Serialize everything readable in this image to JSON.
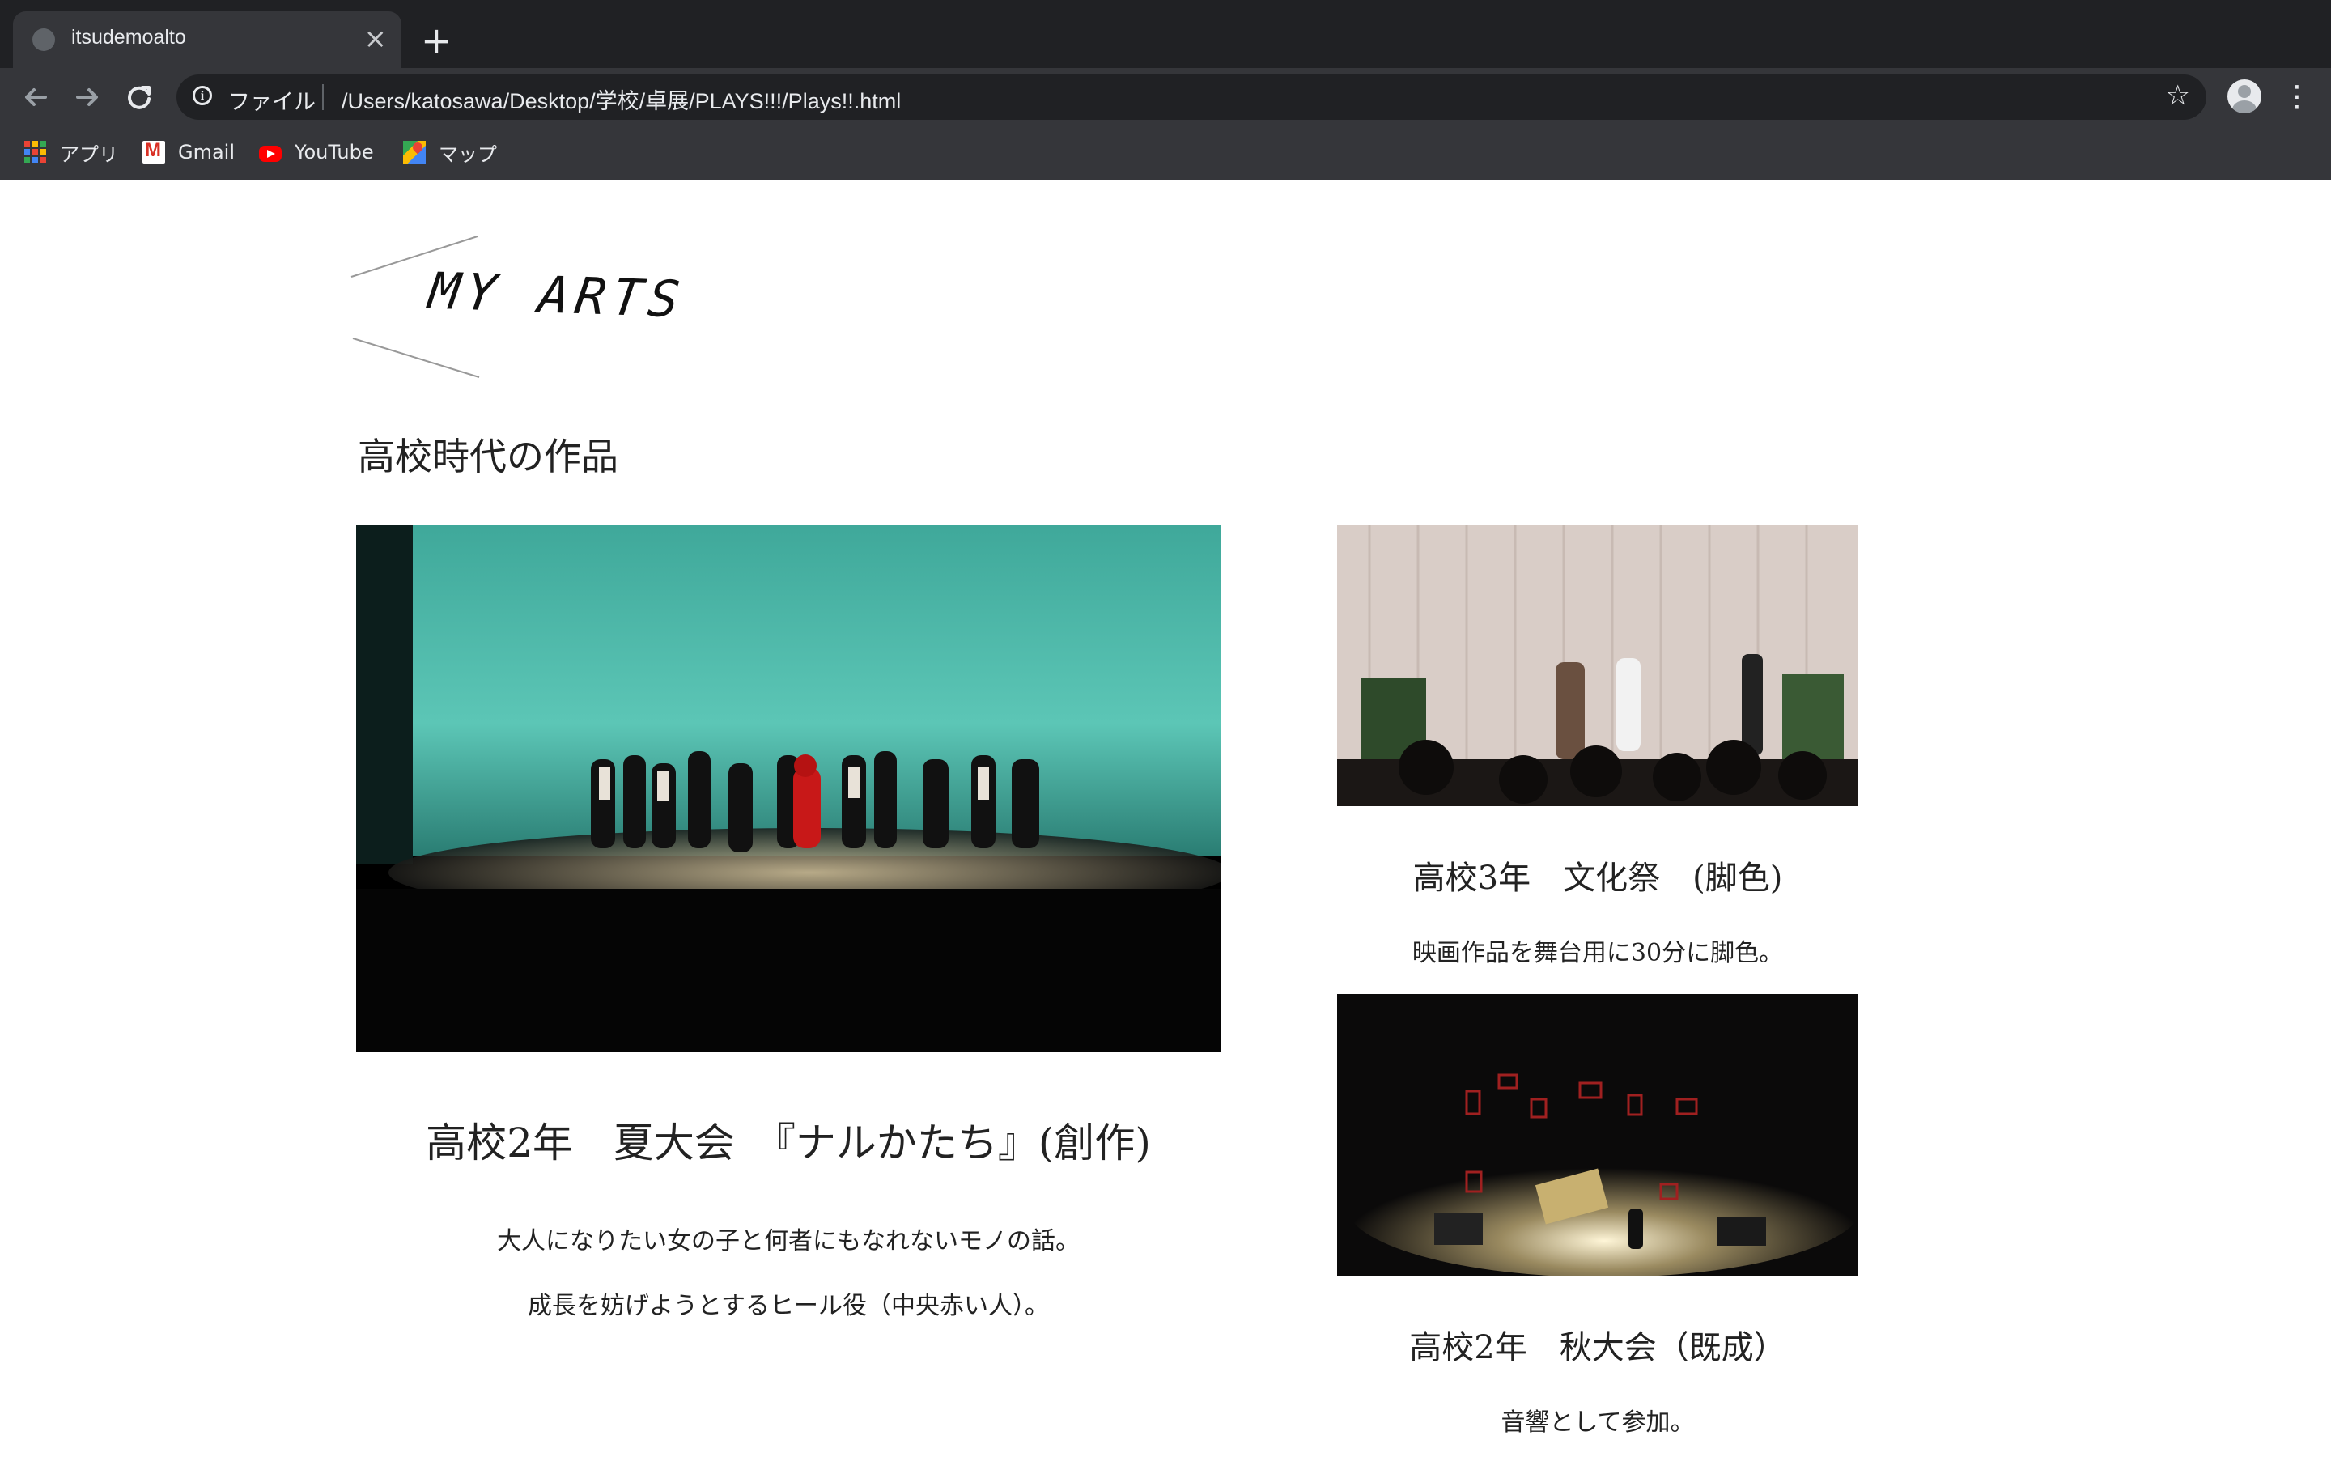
{
  "browser": {
    "tab": {
      "title": "itsudemoalto",
      "close_glyph": "×"
    },
    "new_tab_glyph": "+",
    "address": {
      "scheme_label": "ファイル",
      "url": "/Users/katosawa/Desktop/学校/卓展/PLAYS!!!/Plays!!.html"
    },
    "bookmarks": [
      {
        "label": "アプリ",
        "icon": "apps-grid-icon"
      },
      {
        "label": "Gmail",
        "icon": "gmail-icon"
      },
      {
        "label": "YouTube",
        "icon": "youtube-icon"
      },
      {
        "label": "マップ",
        "icon": "maps-icon"
      }
    ]
  },
  "page": {
    "logo_text": "MY ARTS",
    "section_title": "高校時代の作品",
    "works": [
      {
        "title": "高校2年　夏大会　『ナルかたち』(創作)",
        "descriptions": [
          "大人になりたい女の子と何者にもなれないモノの話。",
          "成長を妨げようとするヒール役（中央赤い人）。"
        ]
      },
      {
        "title": "高校3年　文化祭　(脚色)",
        "descriptions": [
          "映画作品を舞台用に30分に脚色。"
        ]
      },
      {
        "title": "高校2年　秋大会（既成）",
        "descriptions": [
          "音響として参加。"
        ]
      }
    ]
  },
  "colors": {
    "chrome_dark": "#202124",
    "chrome_toolbar": "#35363a",
    "chrome_text": "#e8eaed",
    "stage_teal": "#5cc6b6"
  }
}
